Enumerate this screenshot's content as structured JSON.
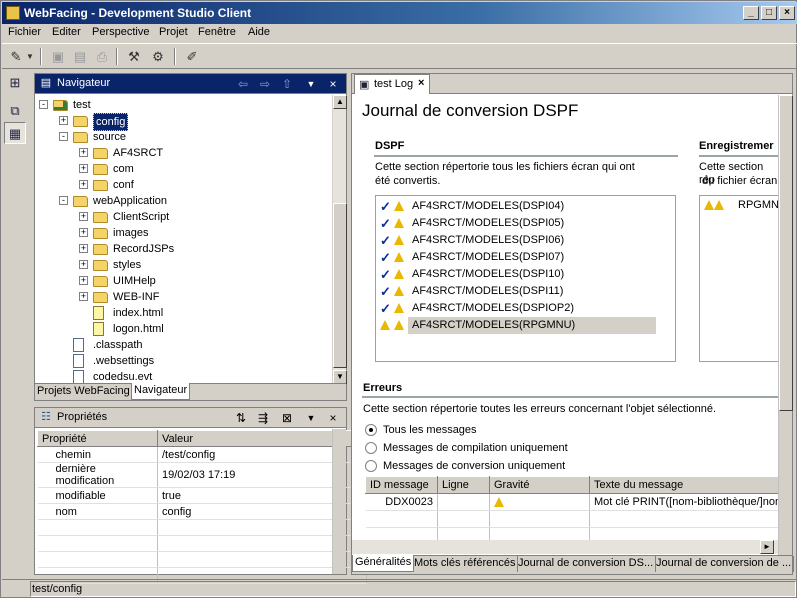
{
  "window": {
    "title": "WebFacing - Development Studio Client",
    "min_label": "_",
    "max_label": "□",
    "close_label": "×"
  },
  "menu": [
    "Fichier",
    "Editer",
    "Perspective",
    "Projet",
    "Fenêtre",
    "Aide"
  ],
  "navigator": {
    "title": "Navigateur",
    "tree": [
      {
        "label": "test",
        "depth": 0,
        "kind": "project",
        "expander": "-"
      },
      {
        "label": "config",
        "depth": 1,
        "kind": "folder",
        "expander": "+",
        "selected": true
      },
      {
        "label": "source",
        "depth": 1,
        "kind": "folder",
        "expander": "-"
      },
      {
        "label": "AF4SRCT",
        "depth": 2,
        "kind": "folder",
        "expander": "+"
      },
      {
        "label": "com",
        "depth": 2,
        "kind": "folder",
        "expander": "+"
      },
      {
        "label": "conf",
        "depth": 2,
        "kind": "folder",
        "expander": "+"
      },
      {
        "label": "webApplication",
        "depth": 1,
        "kind": "folder",
        "expander": "-"
      },
      {
        "label": "ClientScript",
        "depth": 2,
        "kind": "folder",
        "expander": "+"
      },
      {
        "label": "images",
        "depth": 2,
        "kind": "folder",
        "expander": "+"
      },
      {
        "label": "RecordJSPs",
        "depth": 2,
        "kind": "folder",
        "expander": "+"
      },
      {
        "label": "styles",
        "depth": 2,
        "kind": "folder",
        "expander": "+"
      },
      {
        "label": "UIMHelp",
        "depth": 2,
        "kind": "folder",
        "expander": "+"
      },
      {
        "label": "WEB-INF",
        "depth": 2,
        "kind": "folder",
        "expander": "+"
      },
      {
        "label": "index.html",
        "depth": 2,
        "kind": "jsp",
        "expander": ""
      },
      {
        "label": "logon.html",
        "depth": 2,
        "kind": "jsp",
        "expander": ""
      },
      {
        "label": ".classpath",
        "depth": 1,
        "kind": "file",
        "expander": ""
      },
      {
        "label": ".websettings",
        "depth": 1,
        "kind": "file",
        "expander": ""
      },
      {
        "label": "codedsu.evt",
        "depth": 1,
        "kind": "file",
        "expander": ""
      }
    ],
    "tabs": [
      "Projets WebFacing",
      "Navigateur"
    ]
  },
  "properties": {
    "title": "Propriétés",
    "columns": [
      "Propriété",
      "Valeur"
    ],
    "rows": [
      {
        "name": "chemin",
        "value": "/test/config"
      },
      {
        "name": "dernière modification",
        "value": "19/02/03 17:19"
      },
      {
        "name": "modifiable",
        "value": "true"
      },
      {
        "name": "nom",
        "value": "config"
      }
    ]
  },
  "editor": {
    "tab_label": "test Log",
    "form_title": "Journal de conversion DSPF",
    "dspf": {
      "heading": "DSPF",
      "desc1": "Cette section répertorie tous les fichiers écran qui ont",
      "desc2": "été convertis.",
      "items": [
        {
          "label": "AF4SRCT/MODELES(DSPI04)",
          "check": true
        },
        {
          "label": "AF4SRCT/MODELES(DSPI05)",
          "check": true
        },
        {
          "label": "AF4SRCT/MODELES(DSPI06)",
          "check": true
        },
        {
          "label": "AF4SRCT/MODELES(DSPI07)",
          "check": true
        },
        {
          "label": "AF4SRCT/MODELES(DSPI10)",
          "check": true
        },
        {
          "label": "AF4SRCT/MODELES(DSPI11)",
          "check": true
        },
        {
          "label": "AF4SRCT/MODELES(DSPIOP2)",
          "check": true
        },
        {
          "label": "AF4SRCT/MODELES(RPGMNU)",
          "check": false,
          "selected": true
        }
      ]
    },
    "records": {
      "heading": "Enregistremer",
      "desc1": "Cette section rép",
      "desc2": "du fichier écran",
      "items": [
        {
          "label": "RPGMN"
        }
      ]
    },
    "errors": {
      "heading": "Erreurs",
      "desc": "Cette section répertorie toutes les erreurs concernant l'objet sélectionné.",
      "radios": [
        {
          "label": "Tous les messages",
          "checked": true
        },
        {
          "label": "Messages de compilation uniquement",
          "checked": false
        },
        {
          "label": "Messages de conversion uniquement",
          "checked": false
        }
      ],
      "columns": [
        "ID message",
        "Ligne",
        "Gravité",
        "Texte du message"
      ],
      "rows": [
        {
          "id": "DDX0023",
          "line": "",
          "severity": "warning",
          "text": "Mot clé PRINT([nom-bibliothèque/]nom"
        }
      ]
    },
    "bottom_tabs": [
      "Généralités",
      "Mots clés référencés",
      "Journal de conversion DS...",
      "Journal de conversion de ..."
    ]
  },
  "status": {
    "text": "test/config"
  }
}
